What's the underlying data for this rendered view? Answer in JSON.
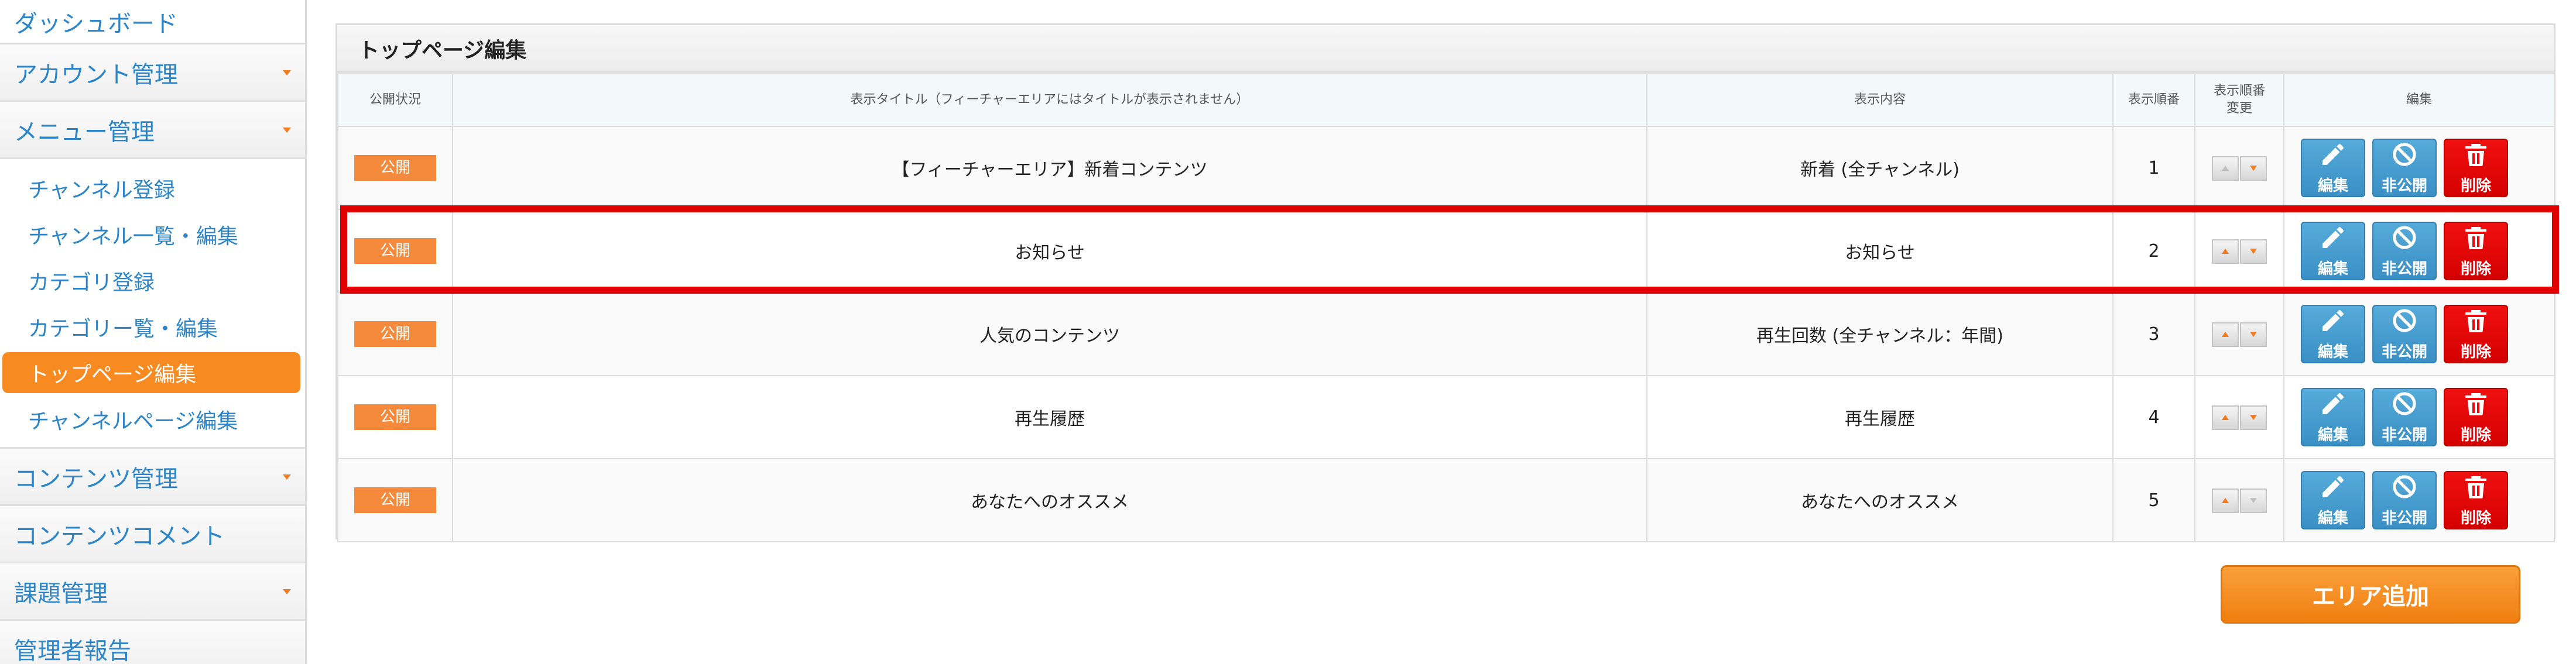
{
  "sidebar": {
    "items": [
      {
        "label": "ダッシュボード"
      },
      {
        "label": "アカウント管理"
      },
      {
        "label": "メニュー管理"
      },
      {
        "label": "コンテンツ管理"
      },
      {
        "label": "コンテンツコメント"
      },
      {
        "label": "課題管理"
      },
      {
        "label": "管理者報告"
      }
    ],
    "submenu": [
      {
        "label": "チャンネル登録"
      },
      {
        "label": "チャンネル一覧・編集"
      },
      {
        "label": "カテゴリ登録"
      },
      {
        "label": "カテゴリー覧・編集"
      },
      {
        "label": "トップページ編集"
      },
      {
        "label": "チャンネルページ編集"
      }
    ]
  },
  "panel": {
    "title": "トップページ編集",
    "headers": {
      "status": "公開状況",
      "title": "表示タイトル（フィーチャーエリアにはタイトルが表示されません）",
      "content": "表示内容",
      "order": "表示順番",
      "order_change_1": "表示順番",
      "order_change_2": "変更",
      "edit": "編集"
    },
    "rows": [
      {
        "status": "公開",
        "title": "【フィーチャーエリア】新着コンテンツ",
        "content": "新着 (全チャンネル)",
        "order": "1"
      },
      {
        "status": "公開",
        "title": "お知らせ",
        "content": "お知らせ",
        "order": "2"
      },
      {
        "status": "公開",
        "title": "人気のコンテンツ",
        "content": "再生回数 (全チャンネル：年間)",
        "order": "3"
      },
      {
        "status": "公開",
        "title": "再生履歴",
        "content": "再生履歴",
        "order": "4"
      },
      {
        "status": "公開",
        "title": "あなたへのオススメ",
        "content": "あなたへのオススメ",
        "order": "5"
      }
    ],
    "actions": {
      "edit": "編集",
      "unpublish": "非公開",
      "delete": "削除"
    }
  },
  "add_area_label": "エリア追加",
  "colors": {
    "accent": "#f88a22",
    "link": "#2b85c8",
    "edit_blue": "#3a8fc4",
    "delete_red": "#e00000",
    "highlight": "#e00000"
  }
}
